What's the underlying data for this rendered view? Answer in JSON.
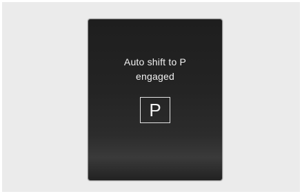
{
  "display": {
    "message_line1": "Auto shift to P",
    "message_line2": "engaged",
    "gear_indicator": "P"
  },
  "colors": {
    "panel_background": "#242424",
    "text": "#f2f2f2",
    "page_background": "#ebebeb"
  }
}
